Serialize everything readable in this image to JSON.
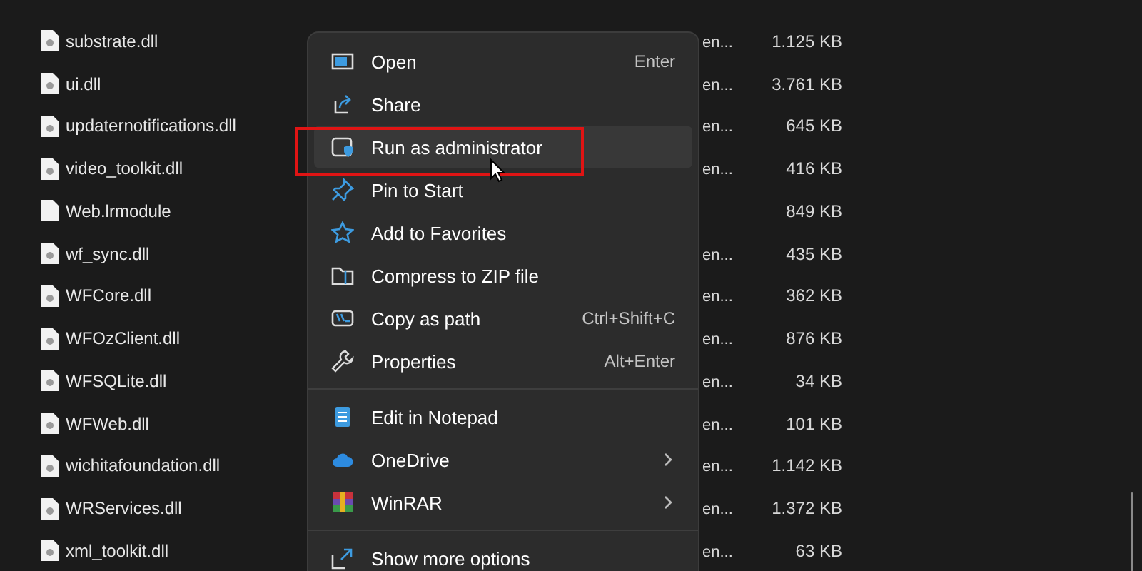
{
  "files": [
    {
      "name": "substrate.dll",
      "type": "en...",
      "size": "1.125 KB",
      "blank_icon": false
    },
    {
      "name": "ui.dll",
      "type": "en...",
      "size": "3.761 KB",
      "blank_icon": false
    },
    {
      "name": "updaternotifications.dll",
      "type": "en...",
      "size": "645 KB",
      "blank_icon": false
    },
    {
      "name": "video_toolkit.dll",
      "type": "en...",
      "size": "416 KB",
      "blank_icon": false
    },
    {
      "name": "Web.lrmodule",
      "size": "849 KB",
      "blank_icon": true
    },
    {
      "name": "wf_sync.dll",
      "type": "en...",
      "size": "435 KB",
      "blank_icon": false
    },
    {
      "name": "WFCore.dll",
      "type": "en...",
      "size": "362 KB",
      "blank_icon": false
    },
    {
      "name": "WFOzClient.dll",
      "type": "en...",
      "size": "876 KB",
      "blank_icon": false
    },
    {
      "name": "WFSQLite.dll",
      "type": "en...",
      "size": "34 KB",
      "blank_icon": false
    },
    {
      "name": "WFWeb.dll",
      "type": "en...",
      "size": "101 KB",
      "blank_icon": false
    },
    {
      "name": "wichitafoundation.dll",
      "type": "en...",
      "size": "1.142 KB",
      "blank_icon": false
    },
    {
      "name": "WRServices.dll",
      "type": "en...",
      "size": "1.372 KB",
      "blank_icon": false
    },
    {
      "name": "xml_toolkit.dll",
      "type": "en...",
      "size": "63 KB",
      "blank_icon": false
    }
  ],
  "context_menu": [
    {
      "kind": "item",
      "label": "Open",
      "shortcut": "Enter",
      "submenu": false,
      "selected": false
    },
    {
      "kind": "item",
      "label": "Share",
      "submenu": false,
      "selected": false
    },
    {
      "kind": "item",
      "label": "Run as administrator",
      "submenu": false,
      "selected": true
    },
    {
      "kind": "item",
      "label": "Pin to Start",
      "submenu": false,
      "selected": false
    },
    {
      "kind": "item",
      "label": "Add to Favorites",
      "submenu": false,
      "selected": false
    },
    {
      "kind": "item",
      "label": "Compress to ZIP file",
      "submenu": false,
      "selected": false
    },
    {
      "kind": "item",
      "label": "Copy as path",
      "shortcut": "Ctrl+Shift+C",
      "submenu": false,
      "selected": false
    },
    {
      "kind": "item",
      "label": "Properties",
      "shortcut": "Alt+Enter",
      "submenu": false,
      "selected": false
    },
    {
      "kind": "divider"
    },
    {
      "kind": "item",
      "label": "Edit in Notepad",
      "submenu": false,
      "selected": false
    },
    {
      "kind": "item",
      "label": "OneDrive",
      "submenu": true,
      "selected": false
    },
    {
      "kind": "item",
      "label": "WinRAR",
      "submenu": true,
      "selected": false
    },
    {
      "kind": "divider"
    },
    {
      "kind": "item",
      "label": "Show more options",
      "submenu": false,
      "selected": false
    }
  ]
}
